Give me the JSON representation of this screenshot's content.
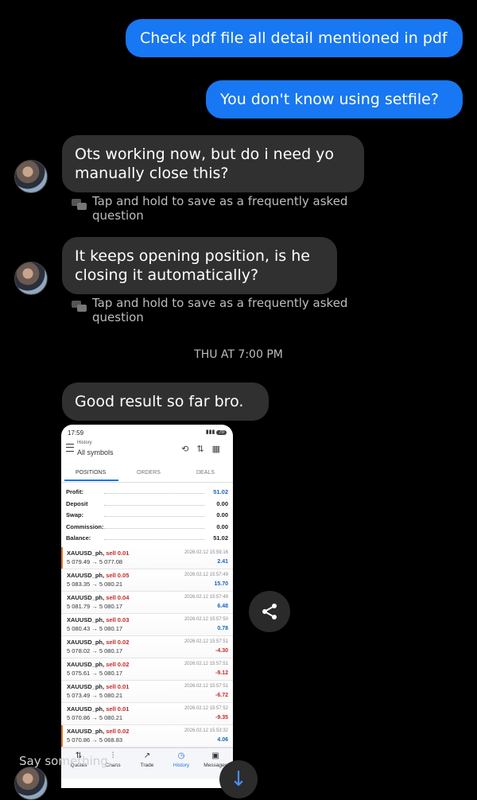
{
  "messages_out": [
    {
      "text": "Check pdf file all detail mentioned in pdf"
    },
    {
      "text": "You don't know using setfile?"
    }
  ],
  "messages_in": [
    {
      "text": "Ots working now, but do i need yo manually close this?"
    },
    {
      "text": "It keeps opening position, is he closing it automatically?"
    },
    {
      "text": "Good result so far bro."
    }
  ],
  "faq_hint": "Tap and hold to save as a frequently asked question",
  "timestamp": "THU AT 7:00 PM",
  "compose_placeholder": "Say something...",
  "screenshot": {
    "status_time": "17:59",
    "battery": "70",
    "header_title": "History",
    "header_subtitle": "All symbols",
    "tabs": [
      "POSITIONS",
      "ORDERS",
      "DEALS"
    ],
    "summary": [
      {
        "label": "Profit:",
        "value": "51.02",
        "accent": "#1565c0"
      },
      {
        "label": "Deposit",
        "value": "0.00"
      },
      {
        "label": "Swap:",
        "value": "0.00"
      },
      {
        "label": "Commission:",
        "value": "0.00"
      },
      {
        "label": "Balance:",
        "value": "51.02"
      }
    ],
    "deals": [
      {
        "symbol": "XAUUSD_ph,",
        "side": "sell 0.01",
        "prices": "5 079.49 → 5 077.08",
        "time": "2026.02.12 15:59:16",
        "pl": "2.41",
        "positive": true,
        "marker": true
      },
      {
        "symbol": "XAUUSD_ph,",
        "side": "sell 0.05",
        "prices": "5 083.35 → 5 080.21",
        "time": "2026.02.12 15:57:49",
        "pl": "15.70",
        "positive": true,
        "marker": false
      },
      {
        "symbol": "XAUUSD_ph,",
        "side": "sell 0.04",
        "prices": "5 081.79 → 5 080.17",
        "time": "2026.02.12 15:57:49",
        "pl": "6.48",
        "positive": true,
        "marker": false
      },
      {
        "symbol": "XAUUSD_ph,",
        "side": "sell 0.03",
        "prices": "5 080.43 → 5 080.17",
        "time": "2026.02.12 15:57:50",
        "pl": "0.78",
        "positive": true,
        "marker": false
      },
      {
        "symbol": "XAUUSD_ph,",
        "side": "sell 0.02",
        "prices": "5 078.02 → 5 080.17",
        "time": "2026.02.12 15:57:51",
        "pl": "-4.30",
        "positive": false,
        "marker": false
      },
      {
        "symbol": "XAUUSD_ph,",
        "side": "sell 0.02",
        "prices": "5 075.61 → 5 080.17",
        "time": "2026.02.12 15:57:51",
        "pl": "-9.12",
        "positive": false,
        "marker": false
      },
      {
        "symbol": "XAUUSD_ph,",
        "side": "sell 0.01",
        "prices": "5 073.49 → 5 080.21",
        "time": "2026.02.12 15:57:51",
        "pl": "-6.72",
        "positive": false,
        "marker": false
      },
      {
        "symbol": "XAUUSD_ph,",
        "side": "sell 0.01",
        "prices": "5 070.86 → 5 080.21",
        "time": "2026.02.12 15:57:52",
        "pl": "-9.35",
        "positive": false,
        "marker": false
      },
      {
        "symbol": "XAUUSD_ph,",
        "side": "sell 0.02",
        "prices": "5 070.86 → 5 068.83",
        "time": "2026.02.12 15:53:32",
        "pl": "4.06",
        "positive": true,
        "marker": true
      }
    ],
    "nav": [
      {
        "label": "Quotes",
        "icon": "quotes-icon",
        "active": false
      },
      {
        "label": "Charts",
        "icon": "charts-icon",
        "active": false
      },
      {
        "label": "Trade",
        "icon": "trade-icon",
        "active": false
      },
      {
        "label": "History",
        "icon": "history-icon",
        "active": true
      },
      {
        "label": "Messages",
        "icon": "messages-icon",
        "active": false
      }
    ]
  },
  "colors": {
    "outgoing_bubble": "#1877f2",
    "incoming_bubble": "#303030",
    "profit_positive": "#1565c0",
    "profit_negative": "#c62828"
  }
}
